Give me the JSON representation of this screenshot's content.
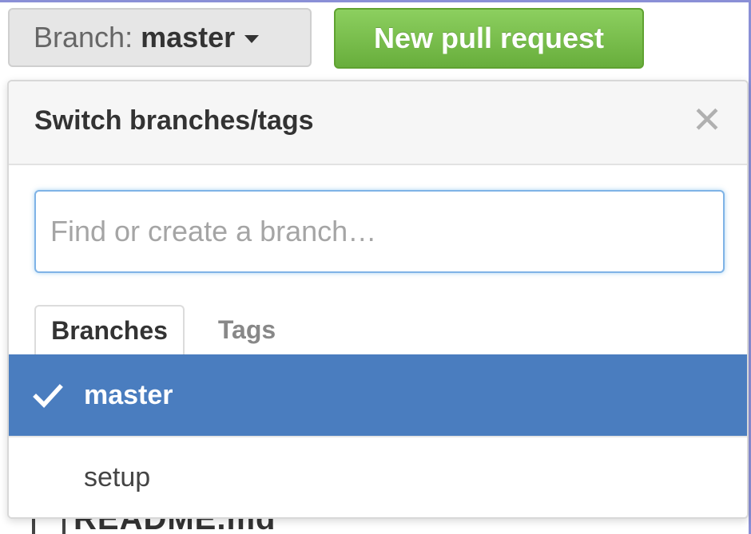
{
  "toolbar": {
    "branch_prefix": "Branch:",
    "branch_name": "master",
    "new_pull_request_label": "New pull request"
  },
  "dropdown": {
    "title": "Switch branches/tags",
    "search_placeholder": "Find or create a branch…",
    "tabs": [
      {
        "label": "Branches",
        "active": true
      },
      {
        "label": "Tags",
        "active": false
      }
    ],
    "branches": [
      {
        "name": "master",
        "selected": true
      },
      {
        "name": "setup",
        "selected": false
      }
    ]
  },
  "background": {
    "readme_label": "README.md"
  },
  "colors": {
    "selected_row": "#4a7dbf",
    "pr_button_green": "#6cc644",
    "focus_blue": "#7fb3e6"
  },
  "icons": {
    "branch_caret": "caret-down-icon",
    "close": "close-icon",
    "selected_check": "check-icon",
    "readme_file": "file-icon"
  }
}
